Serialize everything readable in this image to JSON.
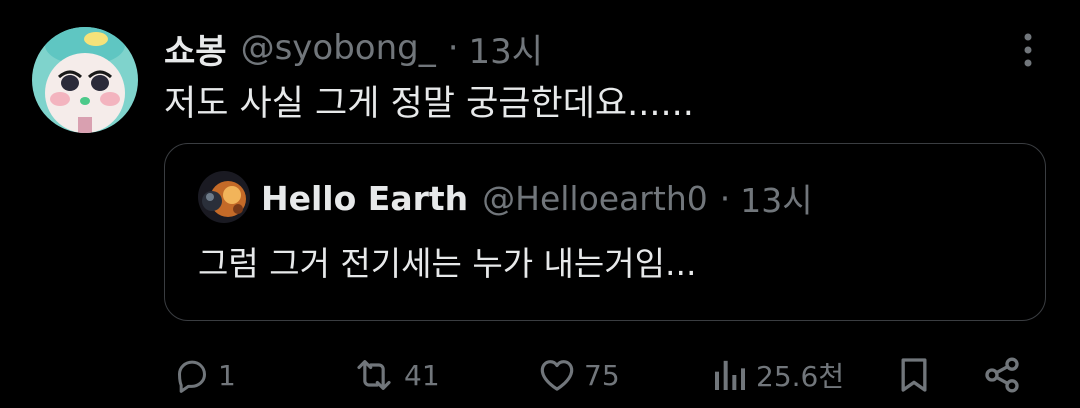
{
  "tweet": {
    "author": {
      "display_name": "쇼봉",
      "handle": "@syobong_",
      "avatar_icon": "character-avatar"
    },
    "separator": "·",
    "time": "13시",
    "text": "저도 사실 그게 정말 궁금한데요......",
    "more_icon": "more-vertical-icon",
    "quoted": {
      "author": {
        "display_name": "Hello Earth",
        "handle": "@Helloearth0",
        "avatar_icon": "earth-avatar"
      },
      "separator": "·",
      "time": "13시",
      "text": "그럼 그거 전기세는 누가 내는거임..."
    },
    "actions": {
      "reply_count": "1",
      "retweet_count": "41",
      "like_count": "75",
      "view_count": "25.6천"
    }
  },
  "colors": {
    "background": "#000000",
    "primary_text": "#e7e9ea",
    "secondary_text": "#71767b",
    "border": "#3a3d41"
  }
}
